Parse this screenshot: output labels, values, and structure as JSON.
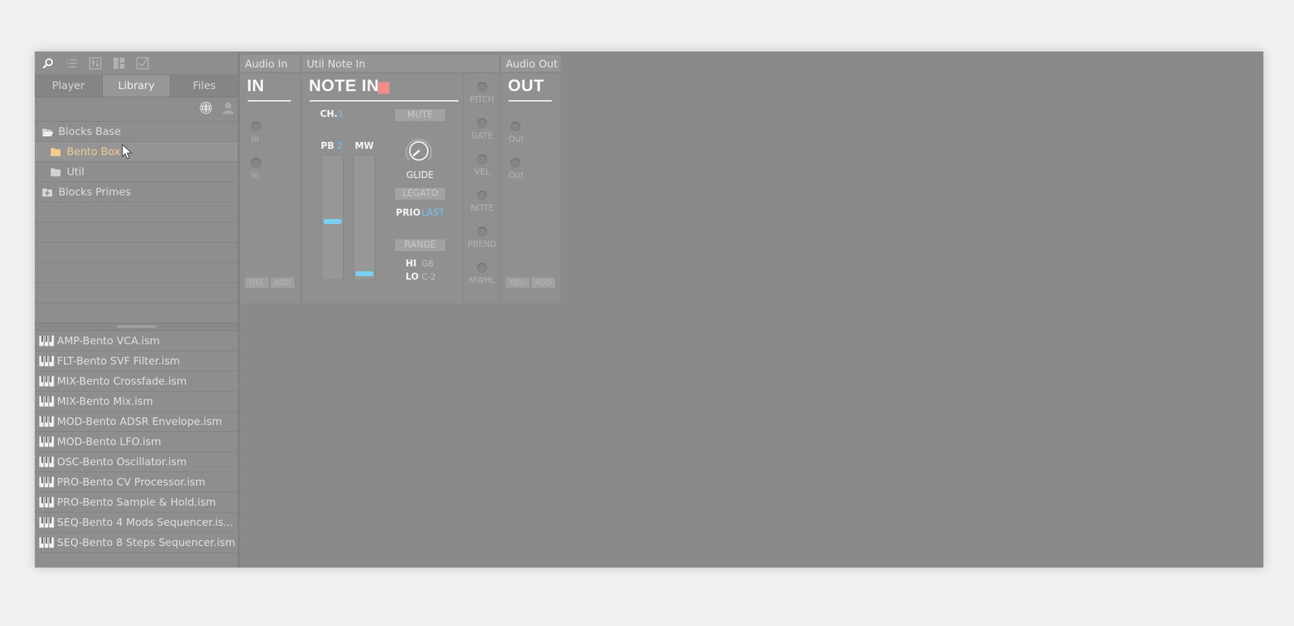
{
  "toolbar": {
    "icons": [
      "search-icon",
      "list-icon",
      "mixer-icon",
      "layout-icon",
      "checkbox-icon"
    ]
  },
  "tabs": [
    {
      "label": "Player",
      "active": false
    },
    {
      "label": "Library",
      "active": true
    },
    {
      "label": "Files",
      "active": false
    }
  ],
  "filter_icons": [
    "globe-icon",
    "user-icon"
  ],
  "tree": [
    {
      "label": "Blocks Base",
      "icon": "folder-open-icon",
      "level": 0,
      "selected": false
    },
    {
      "label": "Bento Box",
      "icon": "folder-icon",
      "level": 1,
      "selected": true
    },
    {
      "label": "Util",
      "icon": "folder-icon",
      "level": 1,
      "selected": false
    },
    {
      "label": "Blocks Primes",
      "icon": "folder-plus-icon",
      "level": 0,
      "selected": false
    }
  ],
  "files": [
    "AMP-Bento VCA.ism",
    "FLT-Bento SVF Filter.ism",
    "MIX-Bento Crossfade.ism",
    "MIX-Bento Mix.ism",
    "MOD-Bento ADSR Envelope.ism",
    "MOD-Bento LFO.ism",
    "OSC-Bento Oscillator.ism",
    "PRO-Bento CV Processor.ism",
    "PRO-Bento Sample & Hold.ism",
    "SEQ-Bento 4 Mods Sequencer.is...",
    "SEQ-Bento 8 Steps Sequencer.ism"
  ],
  "modules": {
    "audio_in": {
      "header": "Audio In",
      "title": "IN",
      "ports": [
        "In",
        "In"
      ],
      "del": "DEL",
      "add": "ADD"
    },
    "note_in": {
      "header": "Util Note In",
      "title": "NOTE IN",
      "indicator_color": "#f08c8c",
      "channel_label": "CH.",
      "channel_value": "1",
      "mute": "MUTE",
      "pb_label": "PB",
      "pb_value": "2",
      "mw_label": "MW",
      "pb_level": 0.47,
      "mw_level": 0.03,
      "glide": "GLIDE",
      "legato": "LEGATO",
      "prio_label": "PRIO",
      "prio_value": "LAST",
      "range": "RANGE",
      "hi_label": "HI",
      "hi_value": "G8",
      "lo_label": "LO",
      "lo_value": "C-2",
      "outputs": [
        "PITCH",
        "GATE",
        "VEL",
        "NOTE",
        "PBEND",
        "MWHL"
      ]
    },
    "audio_out": {
      "header": "Audio Out",
      "title": "OUT",
      "ports": [
        "Out",
        "Out"
      ],
      "del": "DEL",
      "add": "ADD"
    }
  },
  "colors": {
    "accent_value": "#6fc5e8",
    "selected_item": "#f1cc95",
    "background": "#8a8a8b"
  }
}
